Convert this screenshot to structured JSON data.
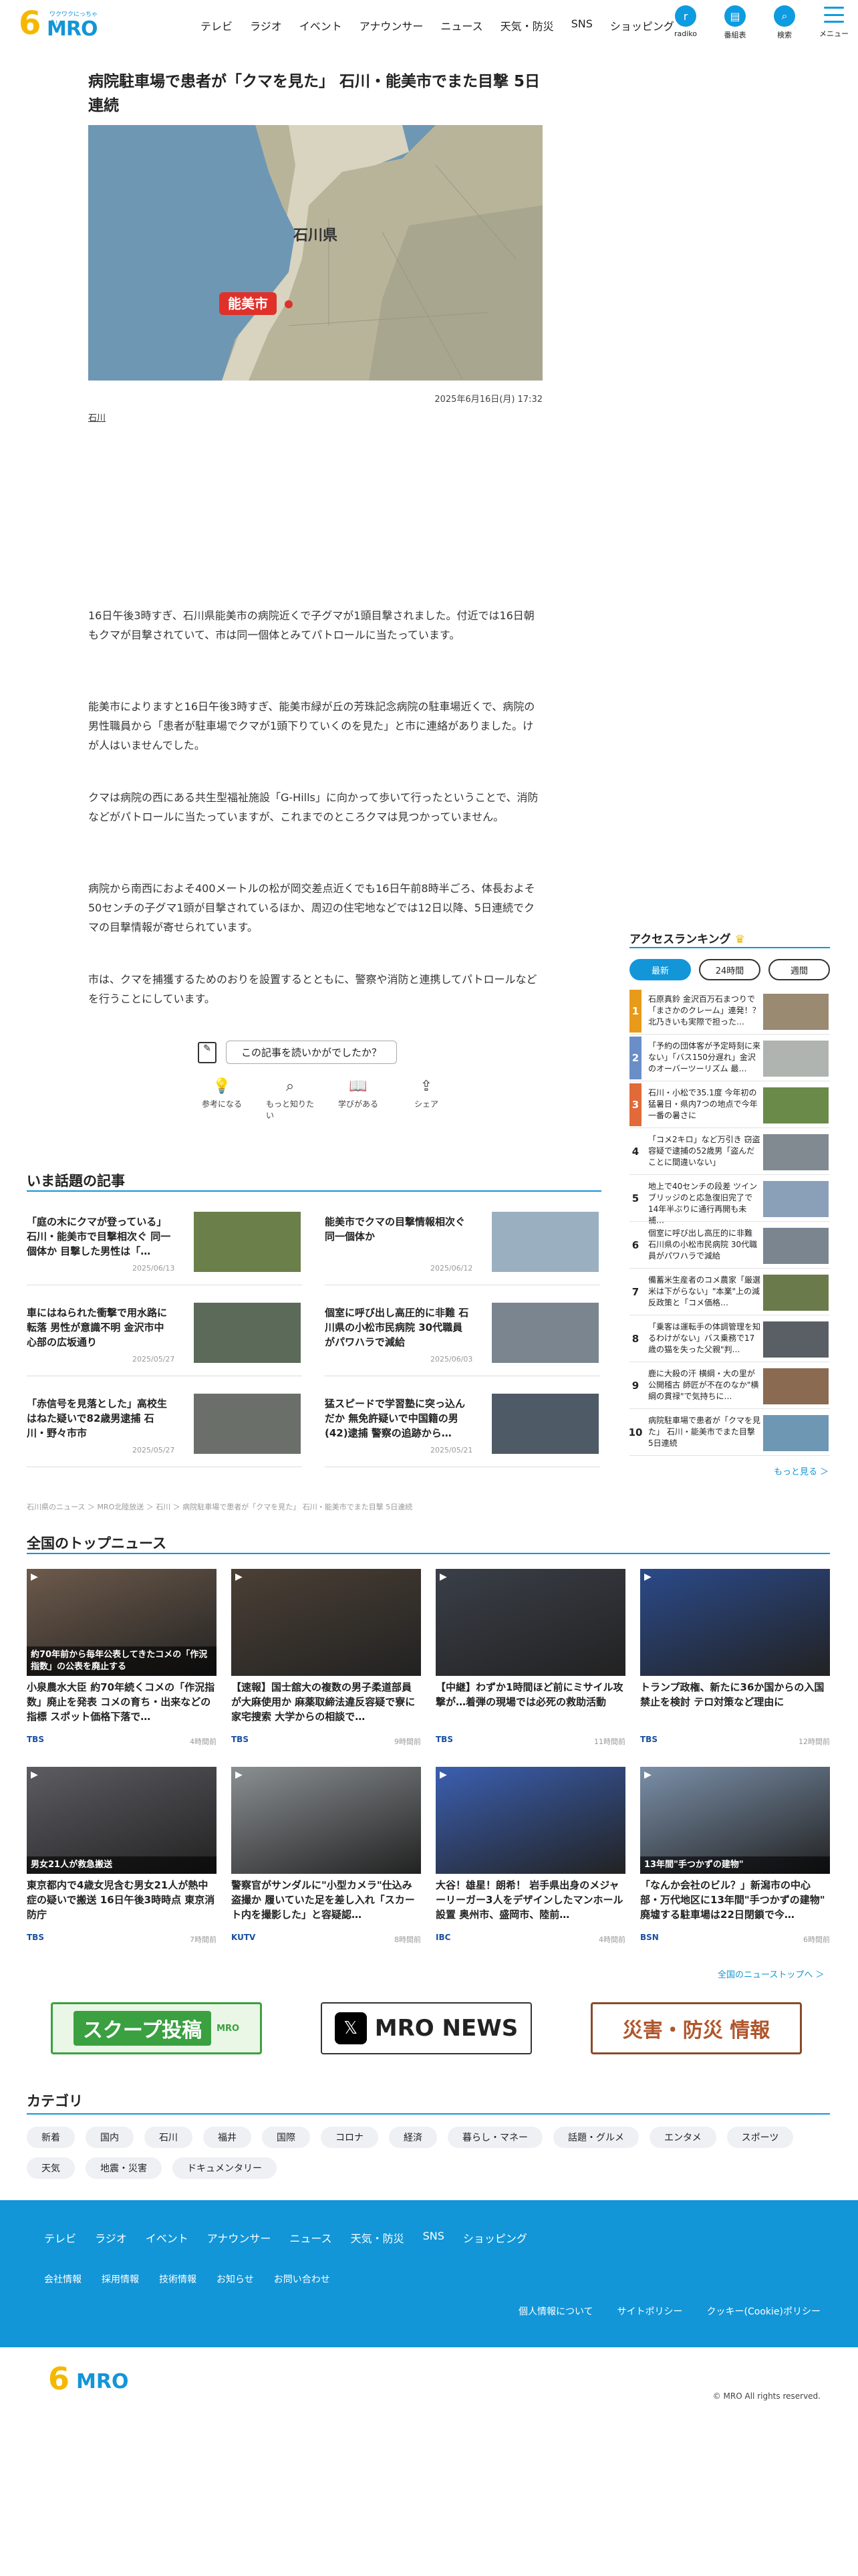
{
  "header": {
    "logo_tag": "ワクワクにっちゃう!",
    "logo_six": "6",
    "logo_mro": "MRO",
    "nav": [
      "テレビ",
      "ラジオ",
      "イベント",
      "アナウンサー",
      "ニュース",
      "天気・防災",
      "SNS",
      "ショッピング"
    ],
    "icons": [
      {
        "label": "radiko",
        "icon": "radio-icon",
        "glyph": "r"
      },
      {
        "label": "番組表",
        "icon": "calendar-icon",
        "glyph": "▤"
      },
      {
        "label": "検索",
        "icon": "search-icon",
        "glyph": "⌕"
      }
    ],
    "menu": "メニュー"
  },
  "article": {
    "title": "病院駐車場で患者が「クマを見た」 石川・能美市でまた目撃 5日連続",
    "map_labels": {
      "pref": "石川県",
      "city": "能美市"
    },
    "date": "2025年6月16日(月) 17:32",
    "tag": "石川",
    "paragraphs": [
      "16日午後3時すぎ、石川県能美市の病院近くで子グマが1頭目撃されました。付近では16日朝もクマが目撃されていて、市は同一個体とみてパトロールに当たっています。",
      "能美市によりますと16日午後3時すぎ、能美市緑が丘の芳珠記念病院の駐車場近くで、病院の男性職員から「患者が駐車場でクマが1頭下りていくのを見た」と市に連絡がありました。けが人はいませんでした。",
      "クマは病院の西にある共生型福祉施設「G-Hills」に向かって歩いて行ったということで、消防などがパトロールに当たっていますが、これまでのところクマは見つかっていません。",
      "病院から南西におよそ400メートルの松が岡交差点近くでも16日午前8時半ごろ、体長およそ50センチの子グマ1頭が目撃されているほか、周辺の住宅地などでは12日以降、5日連続でクマの目撃情報が寄せられています。",
      "市は、クマを捕獲するためのおりを設置するとともに、警察や消防と連携してパトロールなどを行うことにしています。"
    ],
    "feedback_q": "この記事を読いかがでしたか？",
    "reactions": [
      {
        "icon": "lightbulb-icon",
        "glyph": "💡",
        "label": "参考になる"
      },
      {
        "icon": "search-icon",
        "glyph": "⌕",
        "label": "もっと知りたい"
      },
      {
        "icon": "book-icon",
        "glyph": "📖",
        "label": "学びがある"
      },
      {
        "icon": "share-icon",
        "glyph": "⇪",
        "label": "シェア"
      }
    ]
  },
  "topics": {
    "title": "いま話題の記事",
    "items": [
      {
        "title": "「庭の木にクマが登っている」石川・能美市で目撃相次ぐ 同一個体か 目撃した男性は「…",
        "date": "2025/06/13",
        "color": "#6a7f4a"
      },
      {
        "title": "能美市でクマの目撃情報相次ぐ 同一個体か",
        "date": "2025/06/12",
        "color": "#9ab0c0"
      },
      {
        "title": "車にはねられた衝撃で用水路に転落 男性が意識不明 金沢市中心部の広坂通り",
        "date": "2025/05/27",
        "color": "#5c6a5a"
      },
      {
        "title": "個室に呼び出し高圧的に非難 石川県の小松市民病院 30代職員がパワハラで減給",
        "date": "2025/06/03",
        "color": "#7a8590"
      },
      {
        "title": "「赤信号を見落とした」高校生はねた疑いで82歳男逮捕 石川・野々市市",
        "date": "2025/05/27",
        "color": "#6b6f6a"
      },
      {
        "title": "猛スピードで学習塾に突っ込んだか 無免許疑いで中国籍の男(42)逮捕 警察の追跡から…",
        "date": "2025/05/21",
        "color": "#4e5a66"
      }
    ]
  },
  "breadcrumb": "石川県のニュース ＞ MRO北陸放送 ＞ 石川 ＞ 病院駐車場で患者が「クマを見た」 石川・能美市でまた目撃 5日連続",
  "national": {
    "title": "全国のトップニュース",
    "items": [
      {
        "title": "小泉農水大臣 約70年続くコメの「作況指数」廃止を発表 コメの育ち・出来などの指標 スポット価格下落で…",
        "src": "TBS",
        "date": "4時間前",
        "color": "#6d5a4b",
        "cap": "約70年前から毎年公表してきたコメの「作況指数」の公表を廃止する"
      },
      {
        "title": "【速報】国士舘大の複数の男子柔道部員が大麻使用か 麻薬取締法違反容疑で寮に家宅捜索 大学からの相談で…",
        "src": "TBS",
        "date": "9時間前",
        "color": "#4b4035",
        "cap": ""
      },
      {
        "title": "【中継】わずか1時間ほど前にミサイル攻撃が…着弾の現場では必死の救助活動",
        "src": "TBS",
        "date": "11時間前",
        "color": "#3a3f48",
        "cap": ""
      },
      {
        "title": "トランプ政権、新たに36か国からの入国禁止を検討 テロ対策など理由に",
        "src": "TBS",
        "date": "12時間前",
        "color": "#2b4a8a",
        "cap": ""
      },
      {
        "title": "東京都内で4歳女児含む男女21人が熱中症の疑いで搬送 16日午後3時時点 東京消防庁",
        "src": "TBS",
        "date": "7時間前",
        "color": "#5c5c62",
        "cap": "男女21人が救急搬送"
      },
      {
        "title": "警察官がサンダルに\"小型カメラ\"仕込み盗撮か 履いていた足を差し入れ「スカート内を撮影した」と容疑認…",
        "src": "KUTV",
        "date": "8時間前",
        "color": "#8a8f92",
        "cap": ""
      },
      {
        "title": "大谷！雄星！朗希！ 岩手県出身のメジャーリーガー3人をデザインしたマンホール設置 奥州市、盛岡市、陸前…",
        "src": "IBC",
        "date": "4時間前",
        "color": "#3b5fb0",
        "cap": ""
      },
      {
        "title": "「なんか会社のビル？」新潟市の中心部・万代地区に13年間\"手つかずの建物\" 廃墟する駐車場は22日閉鎖で今…",
        "src": "BSN",
        "date": "6時間前",
        "color": "#7a8fa8",
        "cap": "13年間\"手つかずの建物\""
      }
    ],
    "more": "全国のニューストップへ ＞"
  },
  "banners": [
    {
      "label": "スクープ投稿",
      "sub": "MRO",
      "name": "scoop-banner"
    },
    {
      "label": "MRO NEWS",
      "sub": "𝕏",
      "name": "mro-news-x-banner"
    },
    {
      "label": "災害・防災 情報",
      "sub": "",
      "name": "disaster-banner"
    }
  ],
  "categories": {
    "title": "カテゴリ",
    "items": [
      "新着",
      "国内",
      "石川",
      "福井",
      "国際",
      "コロナ",
      "経済",
      "暮らし・マネー",
      "話題・グルメ",
      "エンタメ",
      "スポーツ",
      "天気",
      "地震・災害",
      "ドキュメンタリー"
    ]
  },
  "ranking": {
    "title": "アクセスランキング",
    "tabs": [
      "最新",
      "24時間",
      "週間"
    ],
    "items": [
      {
        "n": "1",
        "t": "石原真鈴 金沢百万石まつりで「まさかのクレーム」連発！？ 北乃きいも実際で担った…",
        "c": "#e89a1a",
        "img": "#9a8a72"
      },
      {
        "n": "2",
        "t": "「予約の団体客が予定時刻に来ない」「バス150分遅れ」金沢のオーバーツーリズム 最…",
        "c": "#6a8ec8",
        "img": "#b0b4b0"
      },
      {
        "n": "3",
        "t": "石川・小松で35.1度 今年初の猛暑日・県内7つの地点で今年一番の暑さに",
        "c": "#e06a3a",
        "img": "#6a8a4a"
      },
      {
        "n": "4",
        "t": "「コメ2キロ」など万引き 窃盗容疑で逮捕の52歳男「盗んだことに間違いない」",
        "c": "#ffffff",
        "img": "#808a90"
      },
      {
        "n": "5",
        "t": "地上で40センチの段差 ツインブリッジのと応急復旧完了で14年半ぶりに通行再開も未補…",
        "c": "#ffffff",
        "img": "#8aa0b8"
      },
      {
        "n": "6",
        "t": "個室に呼び出し高圧的に非難 石川県の小松市民病院 30代職員がパワハラで減給",
        "c": "#ffffff",
        "img": "#7a8590"
      },
      {
        "n": "7",
        "t": "備蓄米生産者のコメ農家「厳選米は下がらない」\"本業\"上の減反政策と「コメ価格…",
        "c": "#ffffff",
        "img": "#6b7a4a"
      },
      {
        "n": "8",
        "t": "「乗客は運転手の体調管理を知るわけがない」バス乗務で17歳の猫を失った父親\"判…",
        "c": "#ffffff",
        "img": "#5a5f66"
      },
      {
        "n": "9",
        "t": "鹿に大殺の汗 横綱・大の里が公開稽古 師匠が不在のなか\"横綱の貫禄\"で気持ちに…",
        "c": "#ffffff",
        "img": "#8a6a50"
      },
      {
        "n": "10",
        "t": "病院駐車場で患者が「クマを見た」 石川・能美市でまた目撃 5日連続",
        "c": "#ffffff",
        "img": "#6e97b4"
      }
    ],
    "more": "もっと見る ＞"
  },
  "footer": {
    "nav": [
      "テレビ",
      "ラジオ",
      "イベント",
      "アナウンサー",
      "ニュース",
      "天気・防災",
      "SNS",
      "ショッピング"
    ],
    "sub": [
      "会社情報",
      "採用情報",
      "技術情報",
      "お知らせ",
      "お問い合わせ"
    ],
    "legal": [
      "個人情報について",
      "サイトポリシー",
      "クッキー(Cookie)ポリシー"
    ],
    "copyright": "© MRO All rights reserved."
  }
}
